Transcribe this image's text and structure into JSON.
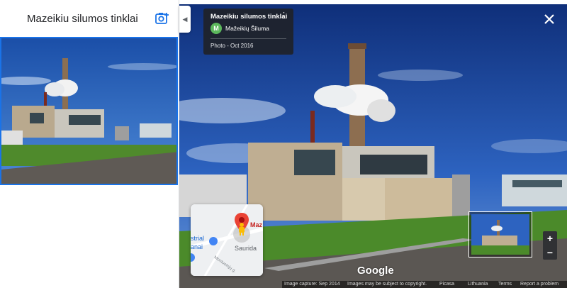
{
  "panel": {
    "title": "Mazeikiu silumos tinklai",
    "add_photo_icon": "add-photo-camera-icon"
  },
  "photo_card": {
    "place_name": "Mazeikiu silumos tinklai",
    "author_initial": "M",
    "author_name": "Mažeikių Šiluma",
    "date": "Photo - Oct 2016"
  },
  "minimap": {
    "labels": [
      "Maz",
      "Saurida",
      "strial",
      "anai",
      "Montuotojų g."
    ]
  },
  "zoom": {
    "in_label": "+",
    "out_label": "−"
  },
  "brand": {
    "logo": "Google"
  },
  "footer": {
    "capture": "Image capture: Sep 2014",
    "copyright": "Images may be subject to copyright.",
    "source": "Picasa",
    "region": "Lithuania",
    "terms": "Terms",
    "report": "Report a problem"
  },
  "colors": {
    "accent": "#1a73e8",
    "card_bg": "#202124",
    "avatar": "#5cb85c",
    "pin": "#ea4335"
  }
}
